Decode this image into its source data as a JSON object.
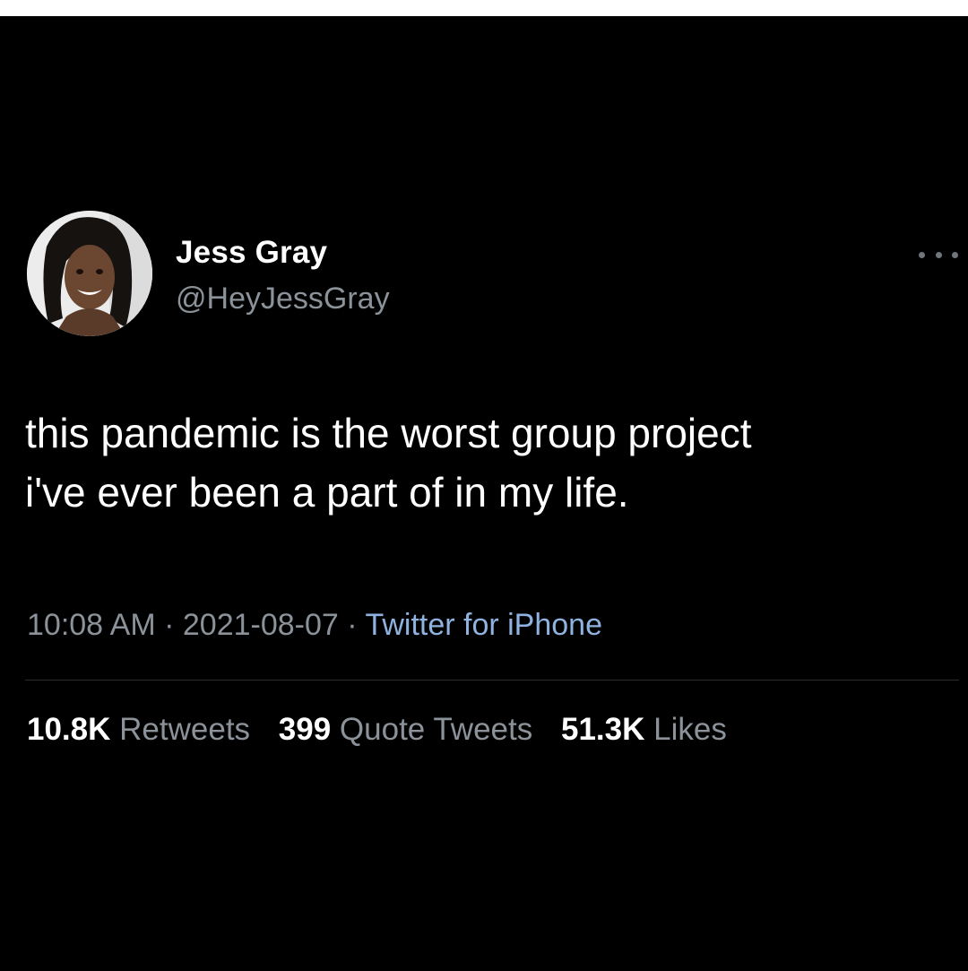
{
  "tweet": {
    "author": {
      "name": "Jess Gray",
      "handle": "@HeyJessGray"
    },
    "text_lines": [
      "this pandemic is the worst group project",
      "i've ever been a part of in my life."
    ],
    "time": "10:08 AM",
    "date": "2021-08-07",
    "separator": "·",
    "source": "Twitter for iPhone",
    "stats": [
      {
        "count": "10.8K",
        "label": "Retweets"
      },
      {
        "count": "399",
        "label": "Quote Tweets"
      },
      {
        "count": "51.3K",
        "label": "Likes"
      }
    ]
  },
  "icons": {
    "more": "more-options-icon"
  },
  "colors": {
    "background": "#000000",
    "text_primary": "#ffffff",
    "text_secondary": "#8b9299",
    "link": "#8fb2e0"
  }
}
